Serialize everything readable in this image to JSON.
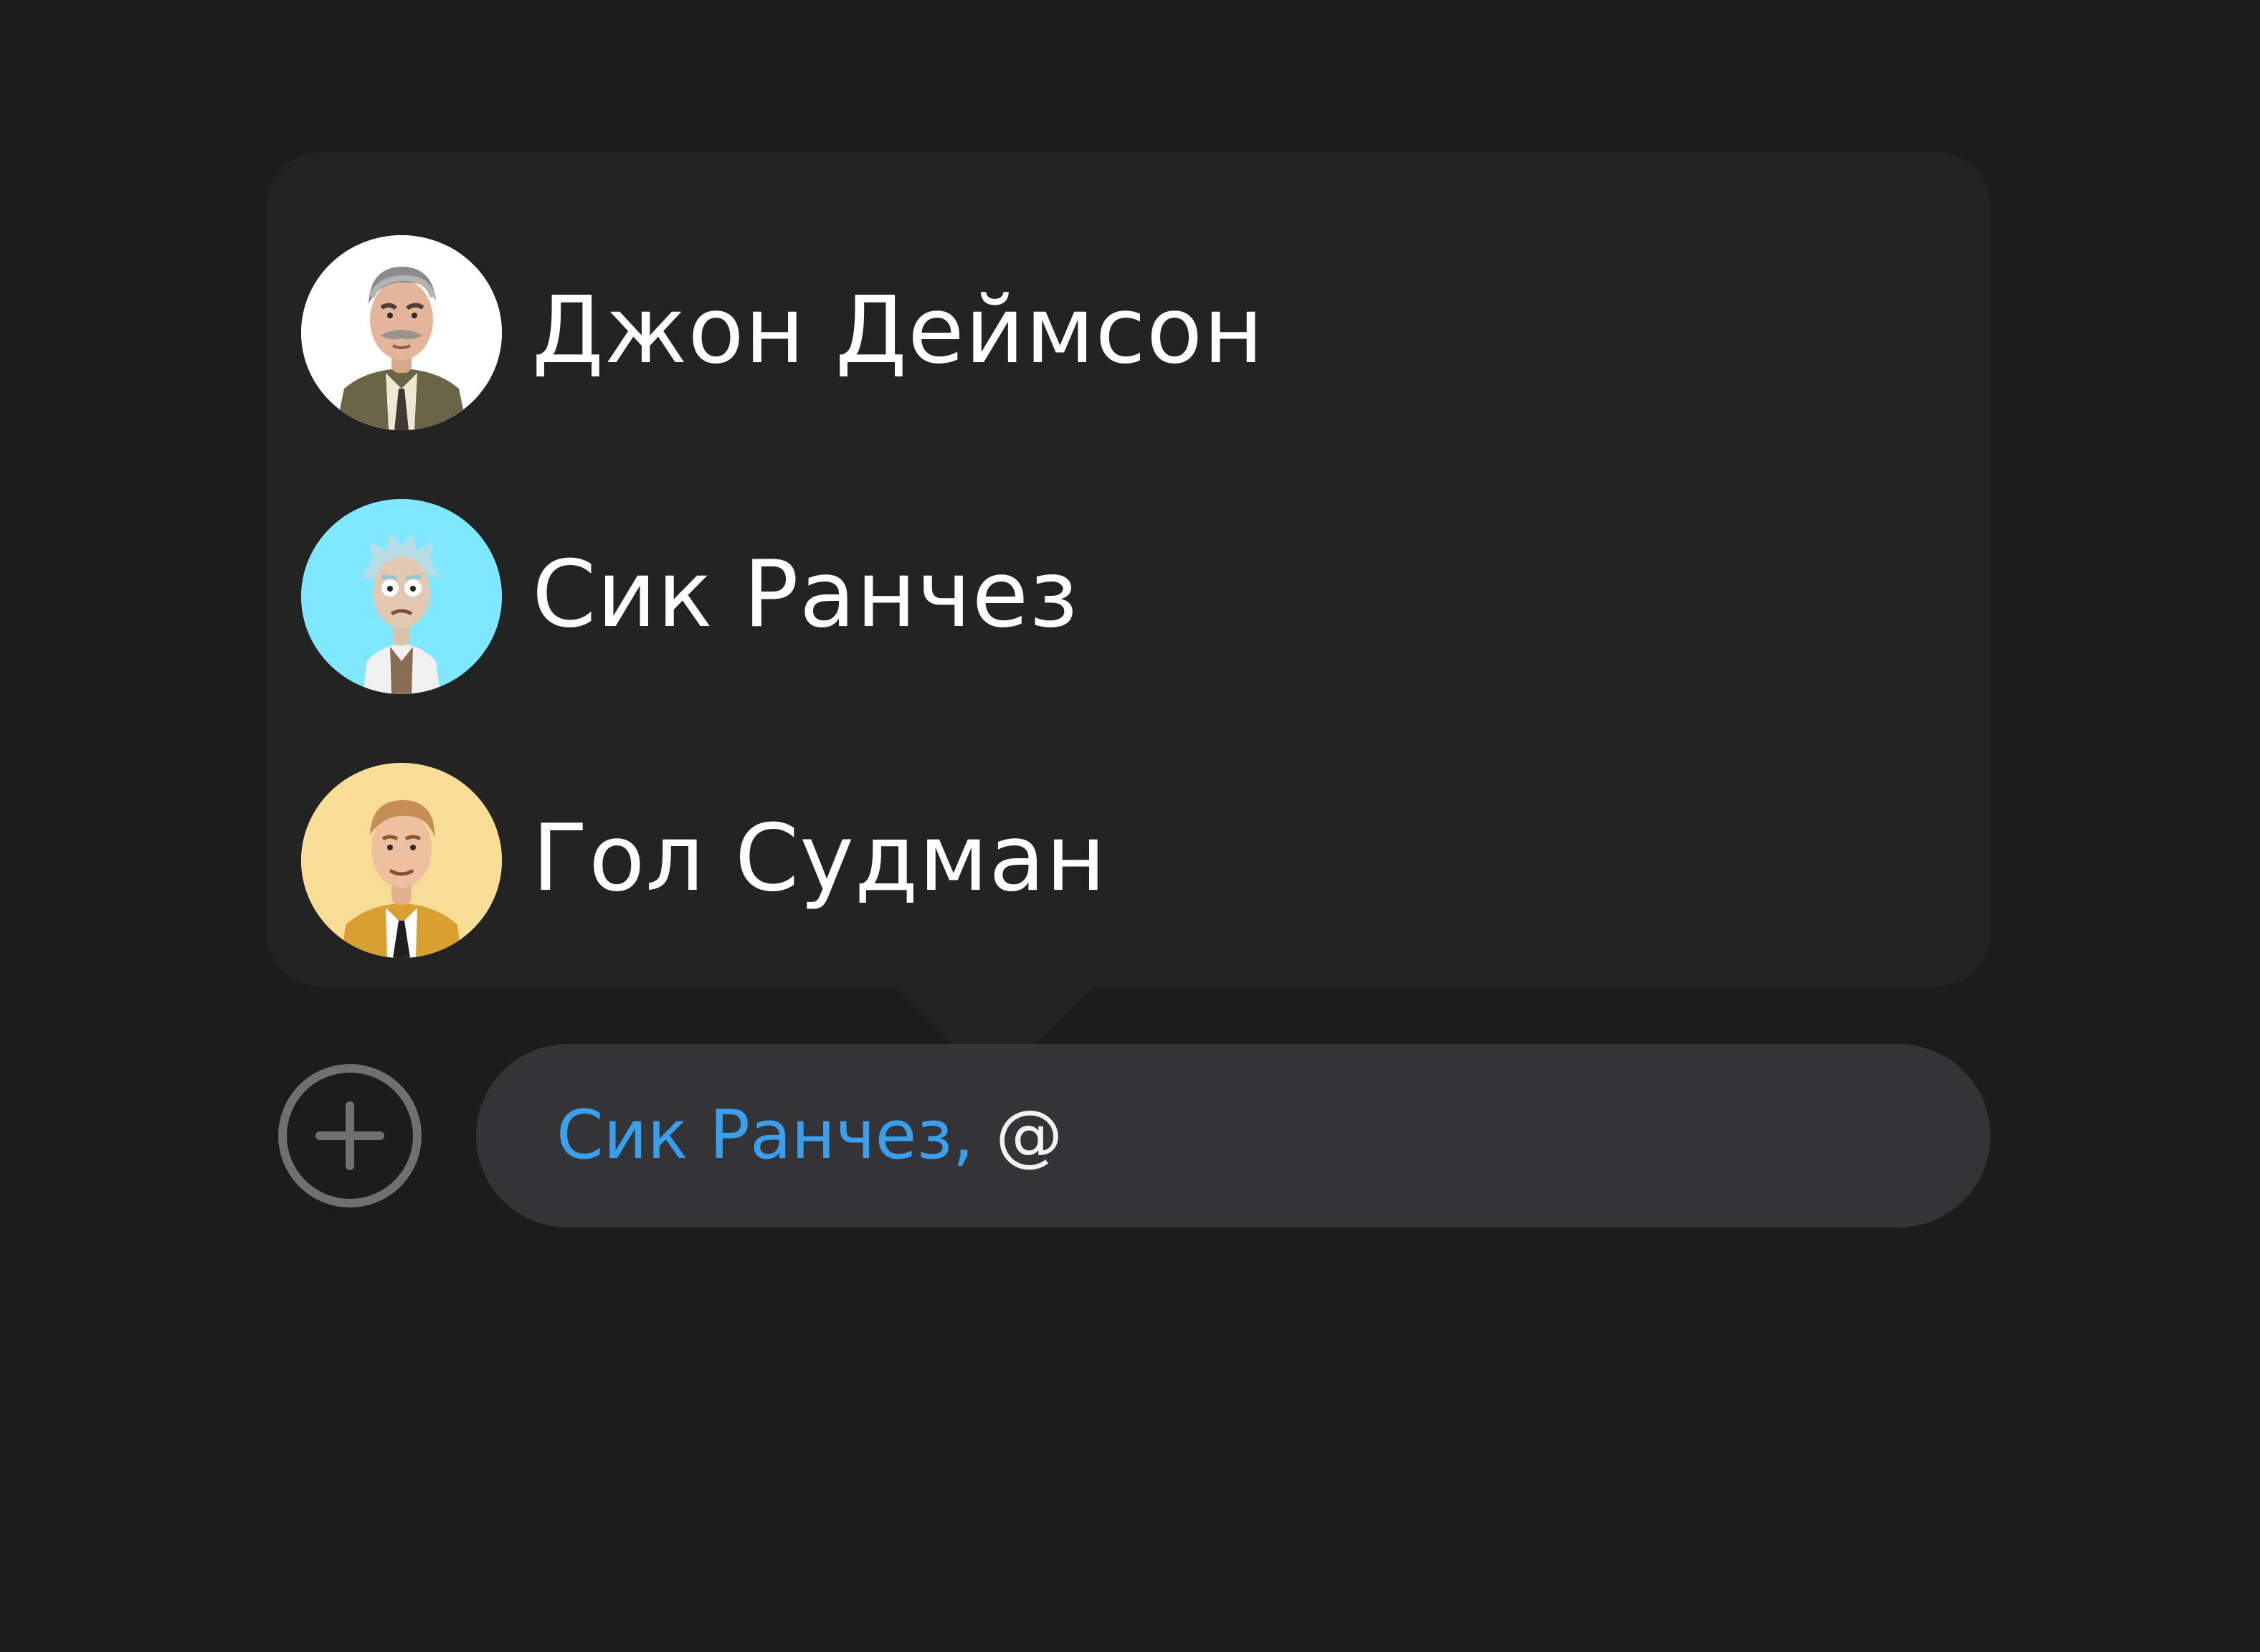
{
  "mention_popup": {
    "items": [
      {
        "name": "Джон Деймсон",
        "avatar_icon": "mustached-man-avatar-icon",
        "avatar_bg": "#ffffff"
      },
      {
        "name": "Сик Ранчез",
        "avatar_icon": "scientist-avatar-icon",
        "avatar_bg": "#7fe7fe"
      },
      {
        "name": "Гол Судман",
        "avatar_icon": "man-in-suit-avatar-icon",
        "avatar_bg": "#f8dd96"
      }
    ]
  },
  "composer": {
    "add_button_icon": "plus-circle-icon",
    "mention_text": "Сик Ранчез,",
    "typed_text": " @"
  },
  "colors": {
    "background": "#1c1c1c",
    "popup_bg": "#232323",
    "input_bg": "#343437",
    "mention_accent": "#3aa0ee"
  }
}
